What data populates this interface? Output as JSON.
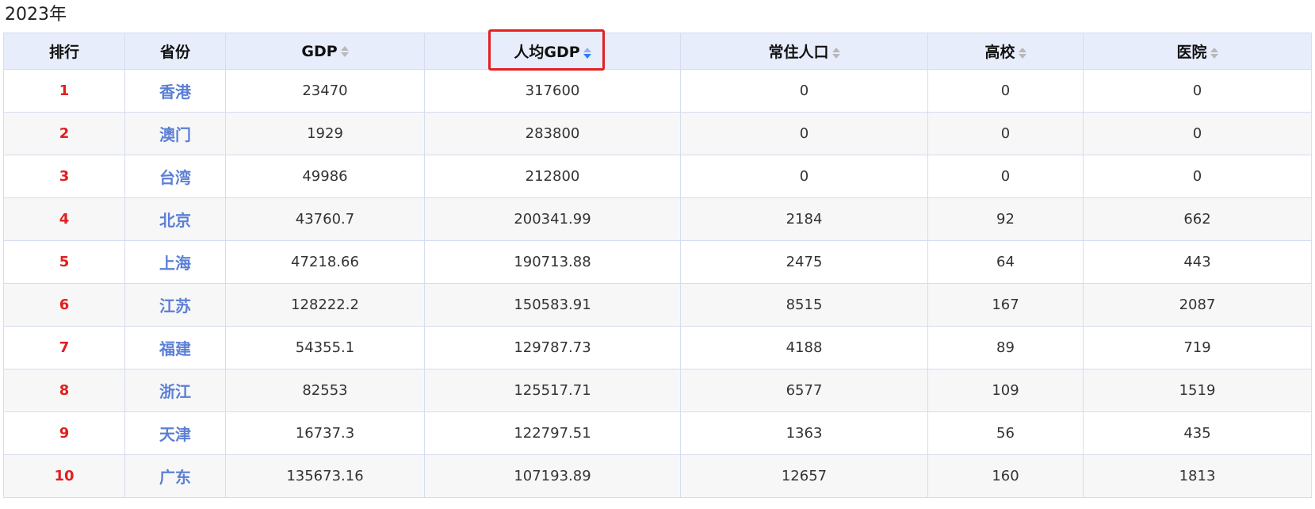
{
  "page": {
    "title": "2023年"
  },
  "table": {
    "headers": [
      {
        "label": "排行",
        "sortable": false
      },
      {
        "label": "省份",
        "sortable": false
      },
      {
        "label": "GDP",
        "sortable": true,
        "active": false
      },
      {
        "label": "人均GDP",
        "sortable": true,
        "active": true,
        "direction": "desc"
      },
      {
        "label": "常住人口",
        "sortable": true,
        "active": false
      },
      {
        "label": "高校",
        "sortable": true,
        "active": false
      },
      {
        "label": "医院",
        "sortable": true,
        "active": false
      }
    ],
    "rows": [
      [
        "1",
        "香港",
        "23470",
        "317600",
        "0",
        "0",
        "0"
      ],
      [
        "2",
        "澳门",
        "1929",
        "283800",
        "0",
        "0",
        "0"
      ],
      [
        "3",
        "台湾",
        "49986",
        "212800",
        "0",
        "0",
        "0"
      ],
      [
        "4",
        "北京",
        "43760.7",
        "200341.99",
        "2184",
        "92",
        "662"
      ],
      [
        "5",
        "上海",
        "47218.66",
        "190713.88",
        "2475",
        "64",
        "443"
      ],
      [
        "6",
        "江苏",
        "128222.2",
        "150583.91",
        "8515",
        "167",
        "2087"
      ],
      [
        "7",
        "福建",
        "54355.1",
        "129787.73",
        "4188",
        "89",
        "719"
      ],
      [
        "8",
        "浙江",
        "82553",
        "125517.71",
        "6577",
        "109",
        "1519"
      ],
      [
        "9",
        "天津",
        "16737.3",
        "122797.51",
        "1363",
        "56",
        "435"
      ],
      [
        "10",
        "广东",
        "135673.16",
        "107193.89",
        "12657",
        "160",
        "1813"
      ]
    ]
  },
  "colors": {
    "rank": "#e02020",
    "province_link": "#5b7fd6",
    "header_bg": "#e8edfc",
    "highlight": "#e32020",
    "sort_active": "#2f7df6"
  }
}
